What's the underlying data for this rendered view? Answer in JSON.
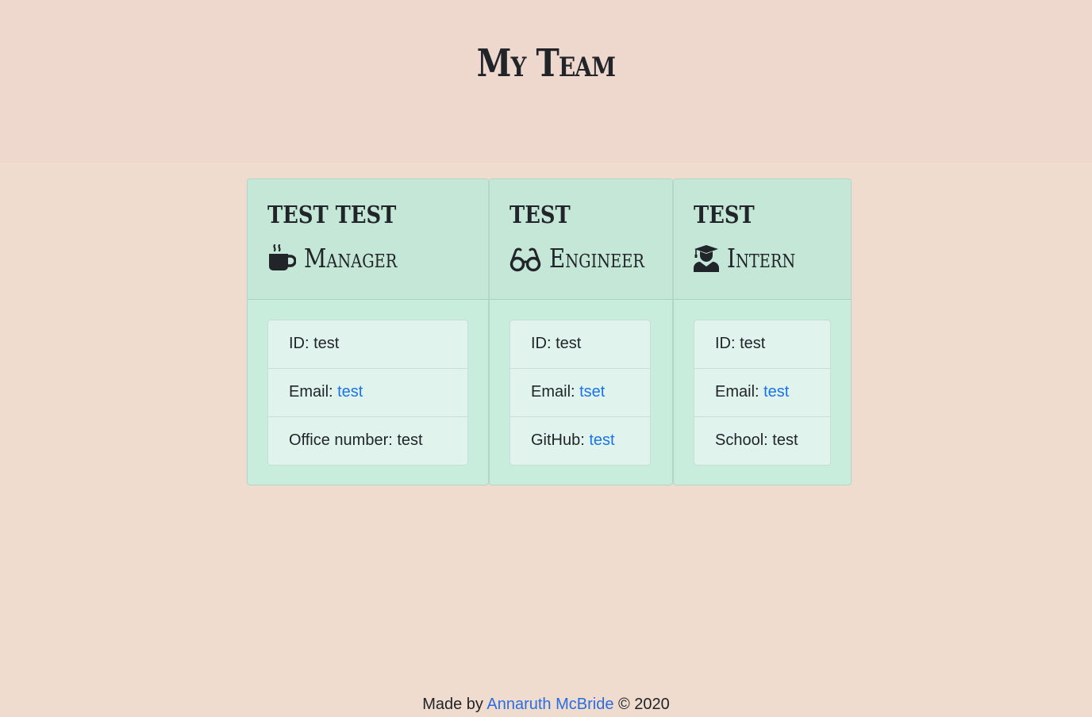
{
  "header": {
    "title": "My Team"
  },
  "cards": [
    {
      "name": "TEST TEST",
      "role": "Manager",
      "icon": "coffee-icon",
      "id_label": "ID: ",
      "id_value": "test",
      "email_label": "Email: ",
      "email_value": "test",
      "extra_label": "Office number: ",
      "extra_value": "test"
    },
    {
      "name": "TEST",
      "role": "Engineer",
      "icon": "glasses-icon",
      "id_label": "ID: ",
      "id_value": "test",
      "email_label": "Email: ",
      "email_value": "tset",
      "extra_label": "GitHub: ",
      "extra_value": "test"
    },
    {
      "name": "TEST",
      "role": "Intern",
      "icon": "graduate-icon",
      "id_label": "ID: ",
      "id_value": "test",
      "email_label": "Email: ",
      "email_value": "test",
      "extra_label": "School: ",
      "extra_value": "test"
    }
  ],
  "footer": {
    "prefix": "Made by ",
    "author": "Annaruth McBride",
    "suffix": " © 2020"
  },
  "colors": {
    "page_background": "#efdcce",
    "header_background": "#eed8cd",
    "card_background": "#c9eddd",
    "link": "#1a73e8"
  }
}
